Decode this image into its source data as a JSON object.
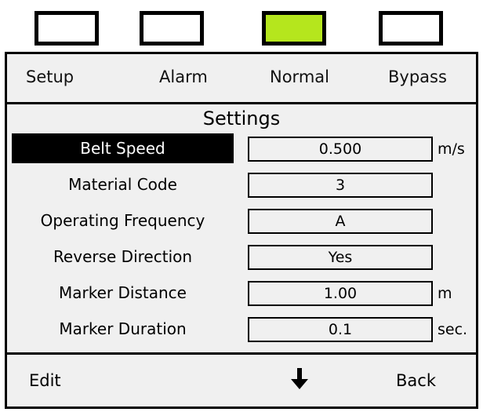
{
  "indicators": [
    {
      "label": "Setup",
      "active": false
    },
    {
      "label": "Alarm",
      "active": false
    },
    {
      "label": "Normal",
      "active": true,
      "color": "#b5e61d"
    },
    {
      "label": "Bypass",
      "active": false
    }
  ],
  "modes": [
    "Setup",
    "Alarm",
    "Normal",
    "Bypass"
  ],
  "title": "Settings",
  "rows": [
    {
      "label": "Belt Speed",
      "value": "0.500",
      "unit": "m/s",
      "selected": true
    },
    {
      "label": "Material Code",
      "value": "3",
      "unit": ""
    },
    {
      "label": "Operating Frequency",
      "value": "A",
      "unit": ""
    },
    {
      "label": "Reverse Direction",
      "value": "Yes",
      "unit": ""
    },
    {
      "label": "Marker Distance",
      "value": "1.00",
      "unit": "m"
    },
    {
      "label": "Marker Duration",
      "value": "0.1",
      "unit": "sec."
    }
  ],
  "softkeys": {
    "left": "Edit",
    "center_icon": "arrow-down-icon",
    "right": "Back"
  }
}
